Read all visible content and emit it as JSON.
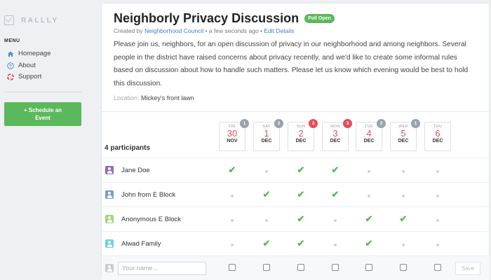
{
  "sidebar": {
    "logo_text": "RALLLY",
    "menu_title": "MENU",
    "items": [
      {
        "label": "Homepage",
        "icon": "home-icon"
      },
      {
        "label": "About",
        "icon": "question-icon"
      },
      {
        "label": "Support",
        "icon": "lifebuoy-icon"
      }
    ],
    "cta_line1": "+ Schedule an",
    "cta_line2": "Event"
  },
  "event": {
    "title": "Neighborly Privacy Discussion",
    "status": "Poll Open",
    "created_by_prefix": "Created by",
    "author": "Neighborhood Council",
    "time_ago": "• a few seconds ago •",
    "edit_link": "Edit Details",
    "description": "Please join us, neighbors, for an open discussion of privacy in our neighborhood and among neighbors. Several people in the district have raised concerns about privacy recently, and we'd like to create some informal rules based on discussion about how to handle such matters. Please let us know which evening would be best to hold this discussion.",
    "location_label": "Location:",
    "location": "Mickey's front lawn"
  },
  "poll": {
    "participants_label": "4 participants",
    "dates": [
      {
        "dow": "FRI",
        "day": "30",
        "month": "NOV",
        "count": "1",
        "hot": false
      },
      {
        "dow": "SAT",
        "day": "1",
        "month": "DEC",
        "count": "2",
        "hot": false
      },
      {
        "dow": "SUN",
        "day": "2",
        "month": "DEC",
        "count": "3",
        "hot": true
      },
      {
        "dow": "MON",
        "day": "3",
        "month": "DEC",
        "count": "3",
        "hot": true
      },
      {
        "dow": "TUE",
        "day": "4",
        "month": "DEC",
        "count": "2",
        "hot": false
      },
      {
        "dow": "WED",
        "day": "5",
        "month": "DEC",
        "count": "1",
        "hot": false
      },
      {
        "dow": "THU",
        "day": "6",
        "month": "DEC",
        "count": "",
        "hot": false
      }
    ],
    "participants": [
      {
        "name": "Jane Doe",
        "avatar_color": "#8e6bbf",
        "votes": [
          true,
          false,
          true,
          true,
          false,
          false,
          false
        ]
      },
      {
        "name": "John from E Block",
        "avatar_color": "#7f98d0",
        "votes": [
          false,
          true,
          true,
          true,
          false,
          false,
          false
        ]
      },
      {
        "name": "Anonymous E Block",
        "avatar_color": "#a7d37e",
        "votes": [
          false,
          false,
          true,
          false,
          true,
          true,
          false
        ]
      },
      {
        "name": "Alwad Family",
        "avatar_color": "#6fd3db",
        "votes": [
          false,
          true,
          true,
          false,
          true,
          false,
          false
        ]
      }
    ],
    "name_placeholder": "Your name...",
    "save_label": "Save"
  },
  "colors": {
    "accent_green": "#5cb85c",
    "date_red": "#e74c5c",
    "link_blue": "#3b82c4"
  }
}
